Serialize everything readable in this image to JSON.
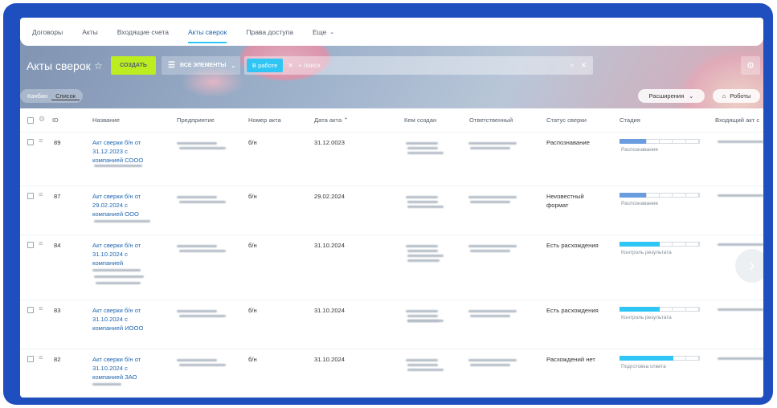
{
  "nav": {
    "tabs": [
      {
        "label": "Договоры"
      },
      {
        "label": "Акты"
      },
      {
        "label": "Входящие счета"
      },
      {
        "label": "Акты сверок"
      },
      {
        "label": "Права доступа"
      },
      {
        "label": "Еще"
      }
    ],
    "active_tab": "Акты сверок"
  },
  "toolbar": {
    "title": "Акты сверок",
    "create_label": "СОЗДАТЬ",
    "filter_label": "ВСЕ ЭЛЕМЕНТЫ",
    "filter_chip": "В работе",
    "search_placeholder": "+ поиск"
  },
  "views": {
    "kanban": "Канбан",
    "list": "Список"
  },
  "extensions_label": "Расширения",
  "robots_label": "Роботы",
  "table": {
    "columns": [
      "ID",
      "Название",
      "Предприятие",
      "Номер акта",
      "Дата акта",
      "Кем создан",
      "Ответственный",
      "Статус сверки",
      "Стадия",
      "Входящий акт с"
    ],
    "rows": [
      {
        "id": "89",
        "name": [
          "Акт сверки б/н от",
          "31.12.2023 с",
          "компанией СООО"
        ],
        "number": "б/н",
        "date": "31.12.0023",
        "status": [
          "Распознавание"
        ],
        "stage": "Распознавание",
        "stage_progress": 0.33,
        "stage_color": "#6a9de0"
      },
      {
        "id": "87",
        "name": [
          "Акт сверки б/н от",
          "29.02.2024 с",
          "компанией ООО"
        ],
        "number": "б/н",
        "date": "29.02.2024",
        "status": [
          "Неизвестный",
          "формат"
        ],
        "stage": "Распознавание",
        "stage_progress": 0.33,
        "stage_color": "#6a9de0"
      },
      {
        "id": "84",
        "name": [
          "Акт сверки б/н от",
          "31.10.2024 с",
          "компанией"
        ],
        "number": "б/н",
        "date": "31.10.2024",
        "status": [
          "Есть расхождения"
        ],
        "stage": "Контроль результата",
        "stage_progress": 0.5,
        "stage_color": "#2fc6f6"
      },
      {
        "id": "83",
        "name": [
          "Акт сверки б/н от",
          "31.10.2024 с",
          "компанией ИООО"
        ],
        "number": "б/н",
        "date": "31.10.2024",
        "status": [
          "Есть расхождения"
        ],
        "stage": "Контроль результата",
        "stage_progress": 0.5,
        "stage_color": "#2fc6f6"
      },
      {
        "id": "82",
        "name": [
          "Акт сверки б/н от",
          "31.10.2024 с",
          "компанией ЗАО"
        ],
        "number": "б/н",
        "date": "31.10.2024",
        "status": [
          "Расхождений нет"
        ],
        "stage": "Подготовка ответа",
        "stage_progress": 0.67,
        "stage_color": "#2fc6f6"
      }
    ]
  }
}
